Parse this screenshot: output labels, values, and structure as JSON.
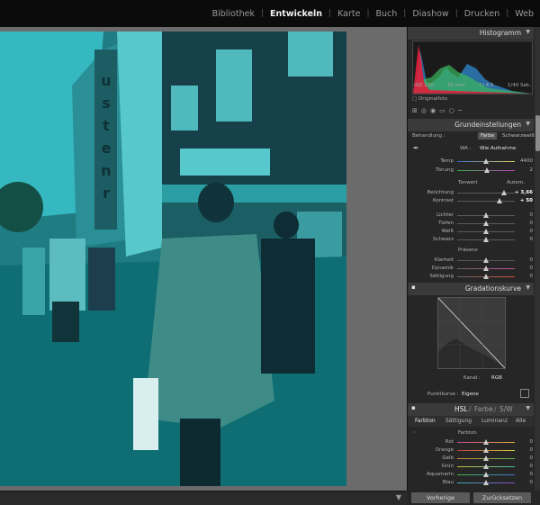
{
  "modules": [
    "Bibliothek",
    "Entwickeln",
    "Karte",
    "Buch",
    "Diashow",
    "Drucken",
    "Web"
  ],
  "active_module": "Entwickeln",
  "histogram": {
    "title": "Histogramm",
    "iso": "ISO 100",
    "focal": "55 mm",
    "aperture": "f / 4,5",
    "shutter": "1/40 Sek.",
    "original_label": "Originalfoto"
  },
  "basic": {
    "title": "Grundeinstellungen",
    "treatment_label": "Behandlung :",
    "treatment_color": "Farbe",
    "treatment_bw": "Schwarzweiß",
    "wb_label": "WA :",
    "wb_value": "Wie Aufnahme",
    "temp": {
      "label": "Temp",
      "value": "4400",
      "pos": 0.5
    },
    "tint": {
      "label": "Tönung",
      "value": "2",
      "pos": 0.52
    },
    "tone_label": "Tonwert",
    "auto_label": "Autom.",
    "exposure": {
      "label": "Belichtung",
      "value": "+ 3,66",
      "pos": 0.82
    },
    "contrast": {
      "label": "Kontrast",
      "value": "+ 50",
      "pos": 0.74
    },
    "highlights": {
      "label": "Lichter",
      "value": "0",
      "pos": 0.5
    },
    "shadows": {
      "label": "Tiefen",
      "value": "0",
      "pos": 0.5
    },
    "whites": {
      "label": "Weiß",
      "value": "0",
      "pos": 0.5
    },
    "blacks": {
      "label": "Schwarz",
      "value": "0",
      "pos": 0.5
    },
    "presence_label": "Präsenz",
    "clarity": {
      "label": "Klarheit",
      "value": "0",
      "pos": 0.5
    },
    "vibrance": {
      "label": "Dynamik",
      "value": "0",
      "pos": 0.5
    },
    "saturation": {
      "label": "Sättigung",
      "value": "0",
      "pos": 0.5
    }
  },
  "tone_curve": {
    "title": "Gradationskurve",
    "channel_label": "Kanal :",
    "channel_value": "RGB",
    "point_curve_label": "Punktkurve :",
    "point_curve_value": "Eigene"
  },
  "hsl": {
    "tab_hsl": "HSL",
    "tab_color": "Farbe",
    "tab_bw": "S/W",
    "sub_hue": "Farbton",
    "sub_sat": "Sättigung",
    "sub_lum": "Luminanz",
    "sub_all": "Alle",
    "section": "Farbton",
    "rows": [
      {
        "label": "Rot",
        "value": "0"
      },
      {
        "label": "Orange",
        "value": "0"
      },
      {
        "label": "Gelb",
        "value": "0"
      },
      {
        "label": "Grün",
        "value": "0"
      },
      {
        "label": "Aquamarin",
        "value": "0"
      },
      {
        "label": "Blau",
        "value": "0"
      }
    ]
  },
  "buttons": {
    "previous": "Vorherige",
    "reset": "Zurücksetzen"
  },
  "colors": {
    "accent_cyan": "#2aa6a8",
    "panel_bg": "#262626",
    "mainview_bg": "#6b6b6b"
  }
}
